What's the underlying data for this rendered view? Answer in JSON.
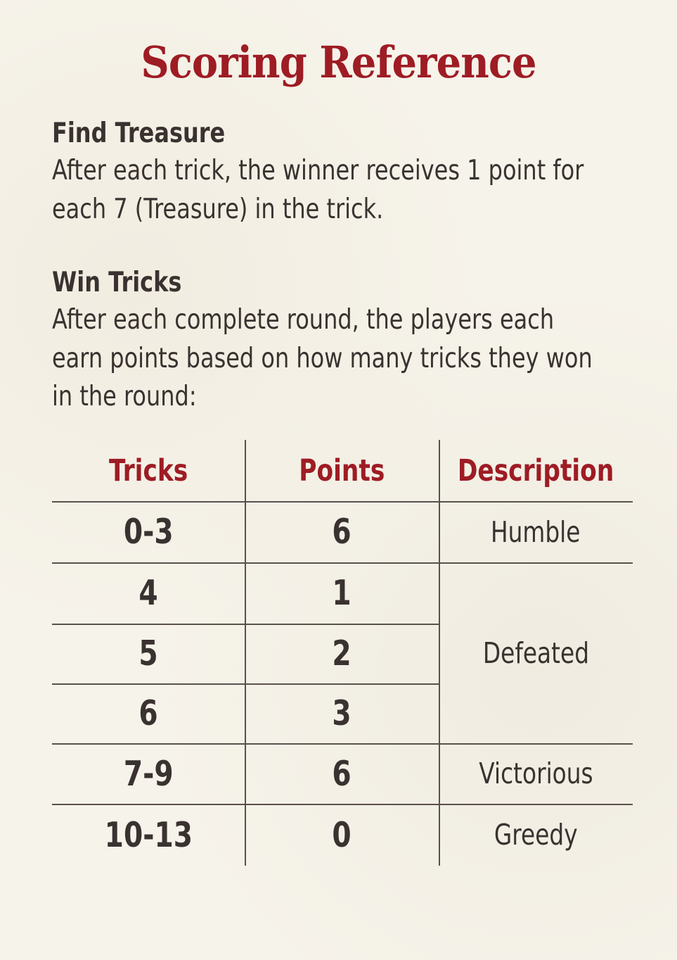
{
  "title": "Scoring Reference",
  "find_treasure": {
    "heading": "Find Treasure",
    "lines": [
      "After each trick, the winner receives 1 point for",
      "each 7 (Treasure) in the trick."
    ]
  },
  "win_tricks": {
    "heading": "Win Tricks",
    "lines": [
      "After each complete round, the players each",
      "earn points based on how many tricks they won",
      "in the round:"
    ]
  },
  "table": {
    "headers": [
      "Tricks",
      "Points",
      "Description"
    ],
    "rows": [
      {
        "tricks": "0-3",
        "points": "6"
      },
      {
        "tricks": "4",
        "points": "1"
      },
      {
        "tricks": "5",
        "points": "2"
      },
      {
        "tricks": "6",
        "points": "3"
      },
      {
        "tricks": "7-9",
        "points": "6"
      },
      {
        "tricks": "10-13",
        "points": "0"
      }
    ],
    "descriptions": [
      "Humble",
      "Defeated",
      "Victorious",
      "Greedy"
    ]
  },
  "colors": {
    "accent": "#9e1c24",
    "text": "#3a3230",
    "background": "#f6f3ea"
  }
}
